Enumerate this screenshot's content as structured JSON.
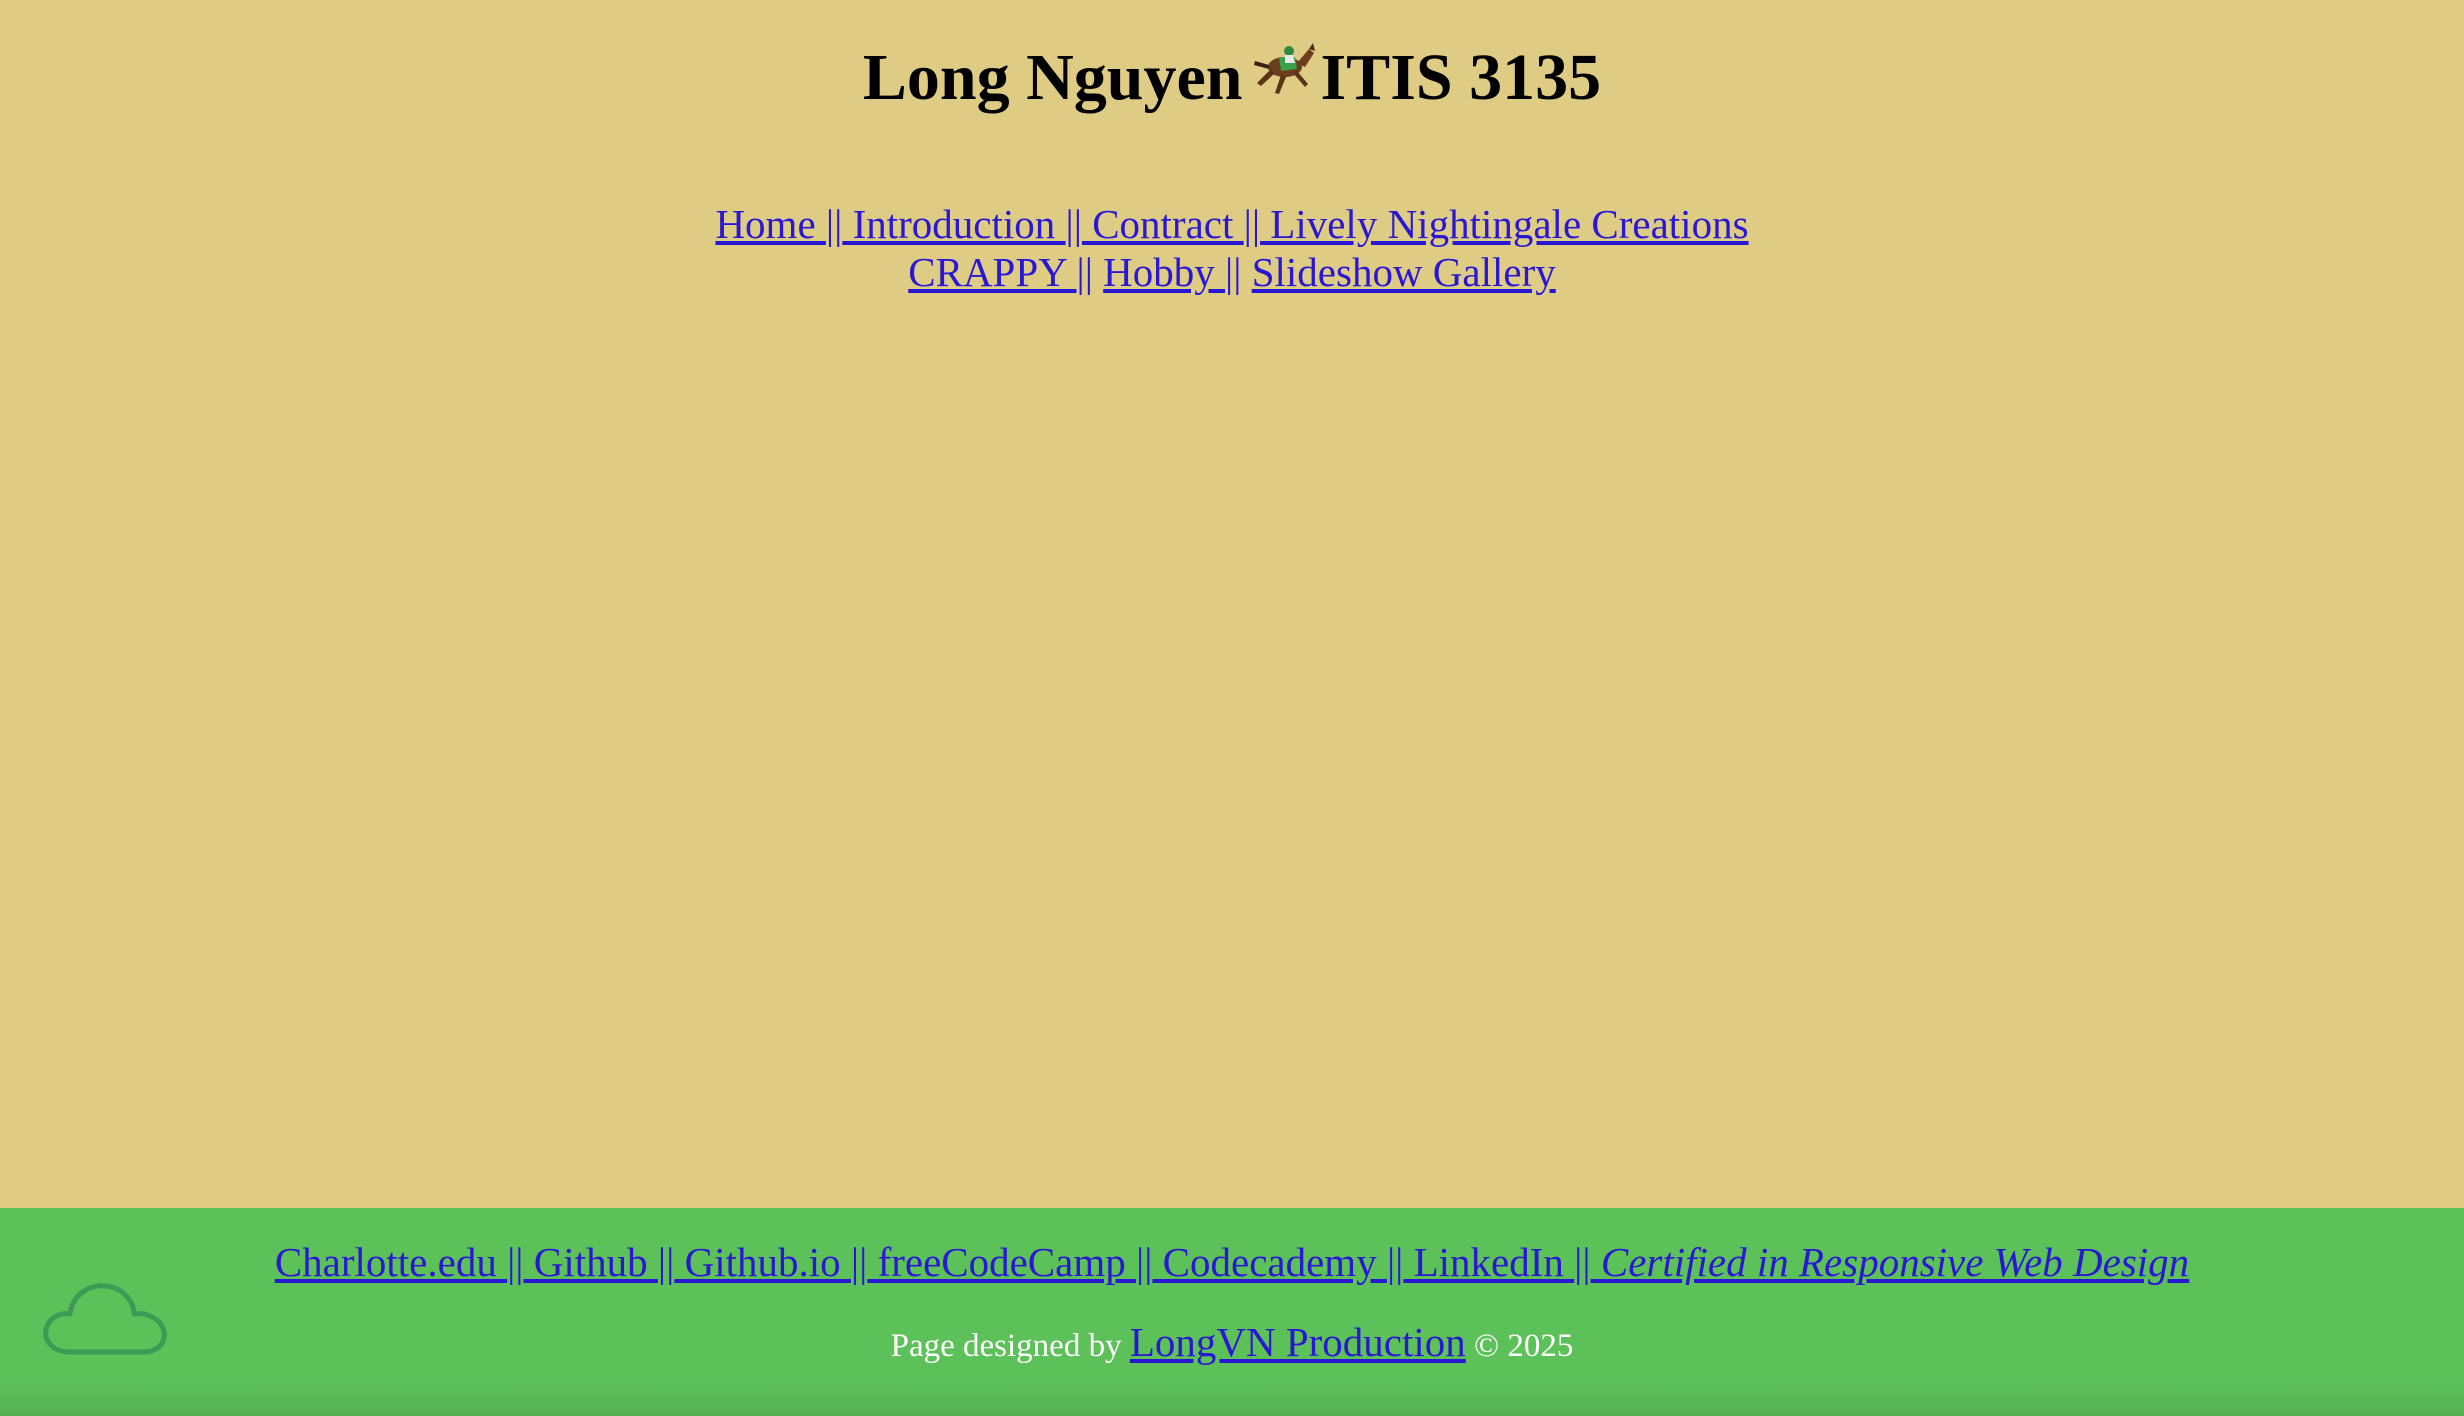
{
  "header": {
    "name": "Long Nguyen",
    "course": "ITIS 3135",
    "emoji_icon": "horse-racing-icon"
  },
  "nav": {
    "row1": [
      {
        "label": "Home ",
        "sep": "||"
      },
      {
        "label": " Introduction ",
        "sep": "||"
      },
      {
        "label": " Contract ",
        "sep": "||"
      },
      {
        "label": " Lively Nightingale Creations"
      }
    ],
    "row2": [
      {
        "label": "CRAPPY ",
        "sep": "||"
      },
      {
        "label": "Hobby ",
        "sep": "||"
      },
      {
        "label": "Slideshow Gallery"
      }
    ]
  },
  "footer": {
    "links": [
      {
        "label": "Charlotte.edu ",
        "sep": "||"
      },
      {
        "label": " Github ",
        "sep": "||"
      },
      {
        "label": " Github.io ",
        "sep": "||"
      },
      {
        "label": " freeCodeCamp ",
        "sep": "||"
      },
      {
        "label": " Codecademy ",
        "sep": "||"
      },
      {
        "label": " LinkedIn ",
        "sep": "||"
      },
      {
        "label": " Certified in Responsive Web Design"
      }
    ],
    "credit_prefix": "Page designed by ",
    "credit_link": "LongVN Production",
    "credit_suffix": " © 2025",
    "cloud_icon": "cloud-icon"
  },
  "colors": {
    "background": "#decb84",
    "footer_bg": "#5dc15a",
    "link": "#2a17d4"
  }
}
